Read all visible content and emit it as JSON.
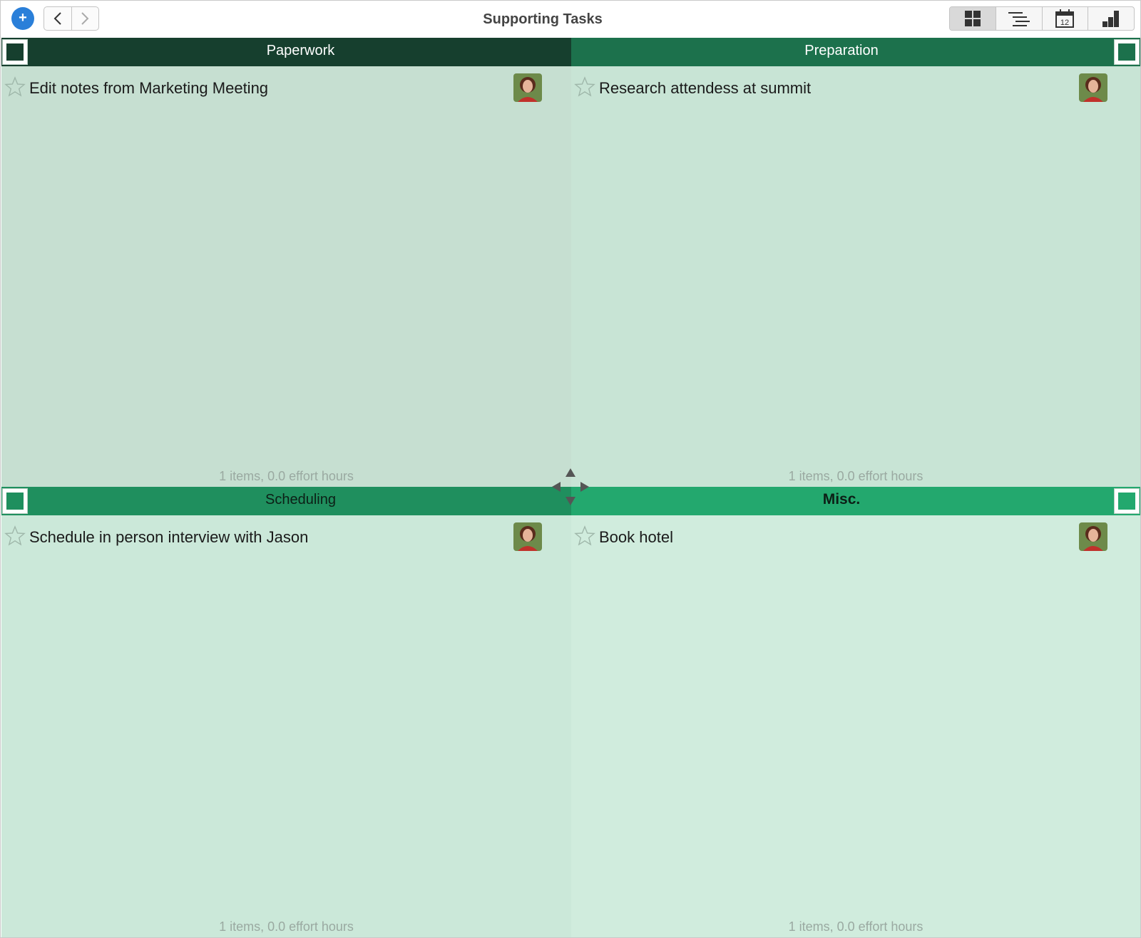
{
  "toolbar": {
    "title": "Supporting Tasks",
    "add_label": "+",
    "views": [
      {
        "icon": "grid-view-icon",
        "active": true
      },
      {
        "icon": "outline-view-icon",
        "active": false
      },
      {
        "icon": "calendar-view-icon",
        "active": false,
        "calendar_day": "12"
      },
      {
        "icon": "chart-view-icon",
        "active": false
      }
    ]
  },
  "quadrants": [
    {
      "title": "Paperwork",
      "header_color": "#163f2e",
      "body_color": "#c6dfd1",
      "task": "Edit notes from Marketing Meeting",
      "footer": "1 items, 0.0 effort hours"
    },
    {
      "title": "Preparation",
      "header_color": "#1c714c",
      "body_color": "#c8e4d5",
      "task": "Research attendess at summit",
      "footer": "1 items, 0.0 effort hours"
    },
    {
      "title": "Scheduling",
      "header_color": "#1f8f5e",
      "body_color": "#cbe8d9",
      "task": "Schedule in person interview with Jason",
      "footer": "1 items, 0.0 effort hours"
    },
    {
      "title": "Misc.",
      "header_color": "#23a86e",
      "body_color": "#d0ecdd",
      "task": "Book hotel",
      "footer": "1 items, 0.0 effort hours"
    }
  ]
}
